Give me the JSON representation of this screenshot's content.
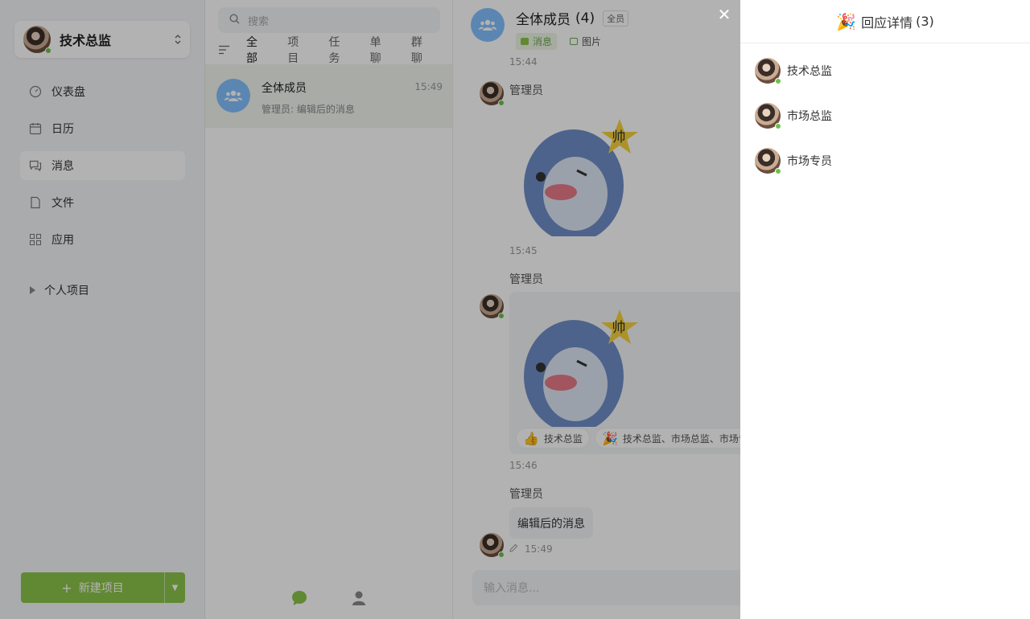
{
  "sidebar": {
    "user_name": "技术总监",
    "nav": [
      {
        "label": "仪表盘",
        "icon": "dashboard-icon"
      },
      {
        "label": "日历",
        "icon": "calendar-icon"
      },
      {
        "label": "消息",
        "icon": "message-icon"
      },
      {
        "label": "文件",
        "icon": "file-icon"
      },
      {
        "label": "应用",
        "icon": "apps-icon"
      }
    ],
    "project_group": "个人项目",
    "new_project_label": "新建项目"
  },
  "conversations": {
    "search_placeholder": "搜索",
    "filters": [
      "全部",
      "项目",
      "任务",
      "单聊",
      "群聊"
    ],
    "item": {
      "title": "全体成员",
      "subtitle": "管理员: 编辑后的消息",
      "time": "15:49"
    }
  },
  "chat": {
    "title": "全体成员",
    "count": "(4)",
    "badge": "全员",
    "tabs": [
      "消息",
      "图片"
    ],
    "timestamps": [
      "15:44",
      "15:45",
      "15:46",
      "15:49"
    ],
    "sender": "管理员",
    "sticker_text": "帅",
    "reactions": [
      {
        "emoji": "👍",
        "users": "技术总监"
      },
      {
        "emoji": "🎉",
        "users": "技术总监、市场总监、市场专员"
      }
    ],
    "text_message": "编辑后的消息",
    "input_placeholder": "输入消息..."
  },
  "drawer": {
    "emoji": "🎉",
    "title": "回应详情",
    "count": "(3)",
    "users": [
      "技术总监",
      "市场总监",
      "市场专员"
    ]
  },
  "colors": {
    "brand_green": "#8bc34a",
    "online_dot": "#6cc24a",
    "group_avatar": "#84c1ff"
  }
}
